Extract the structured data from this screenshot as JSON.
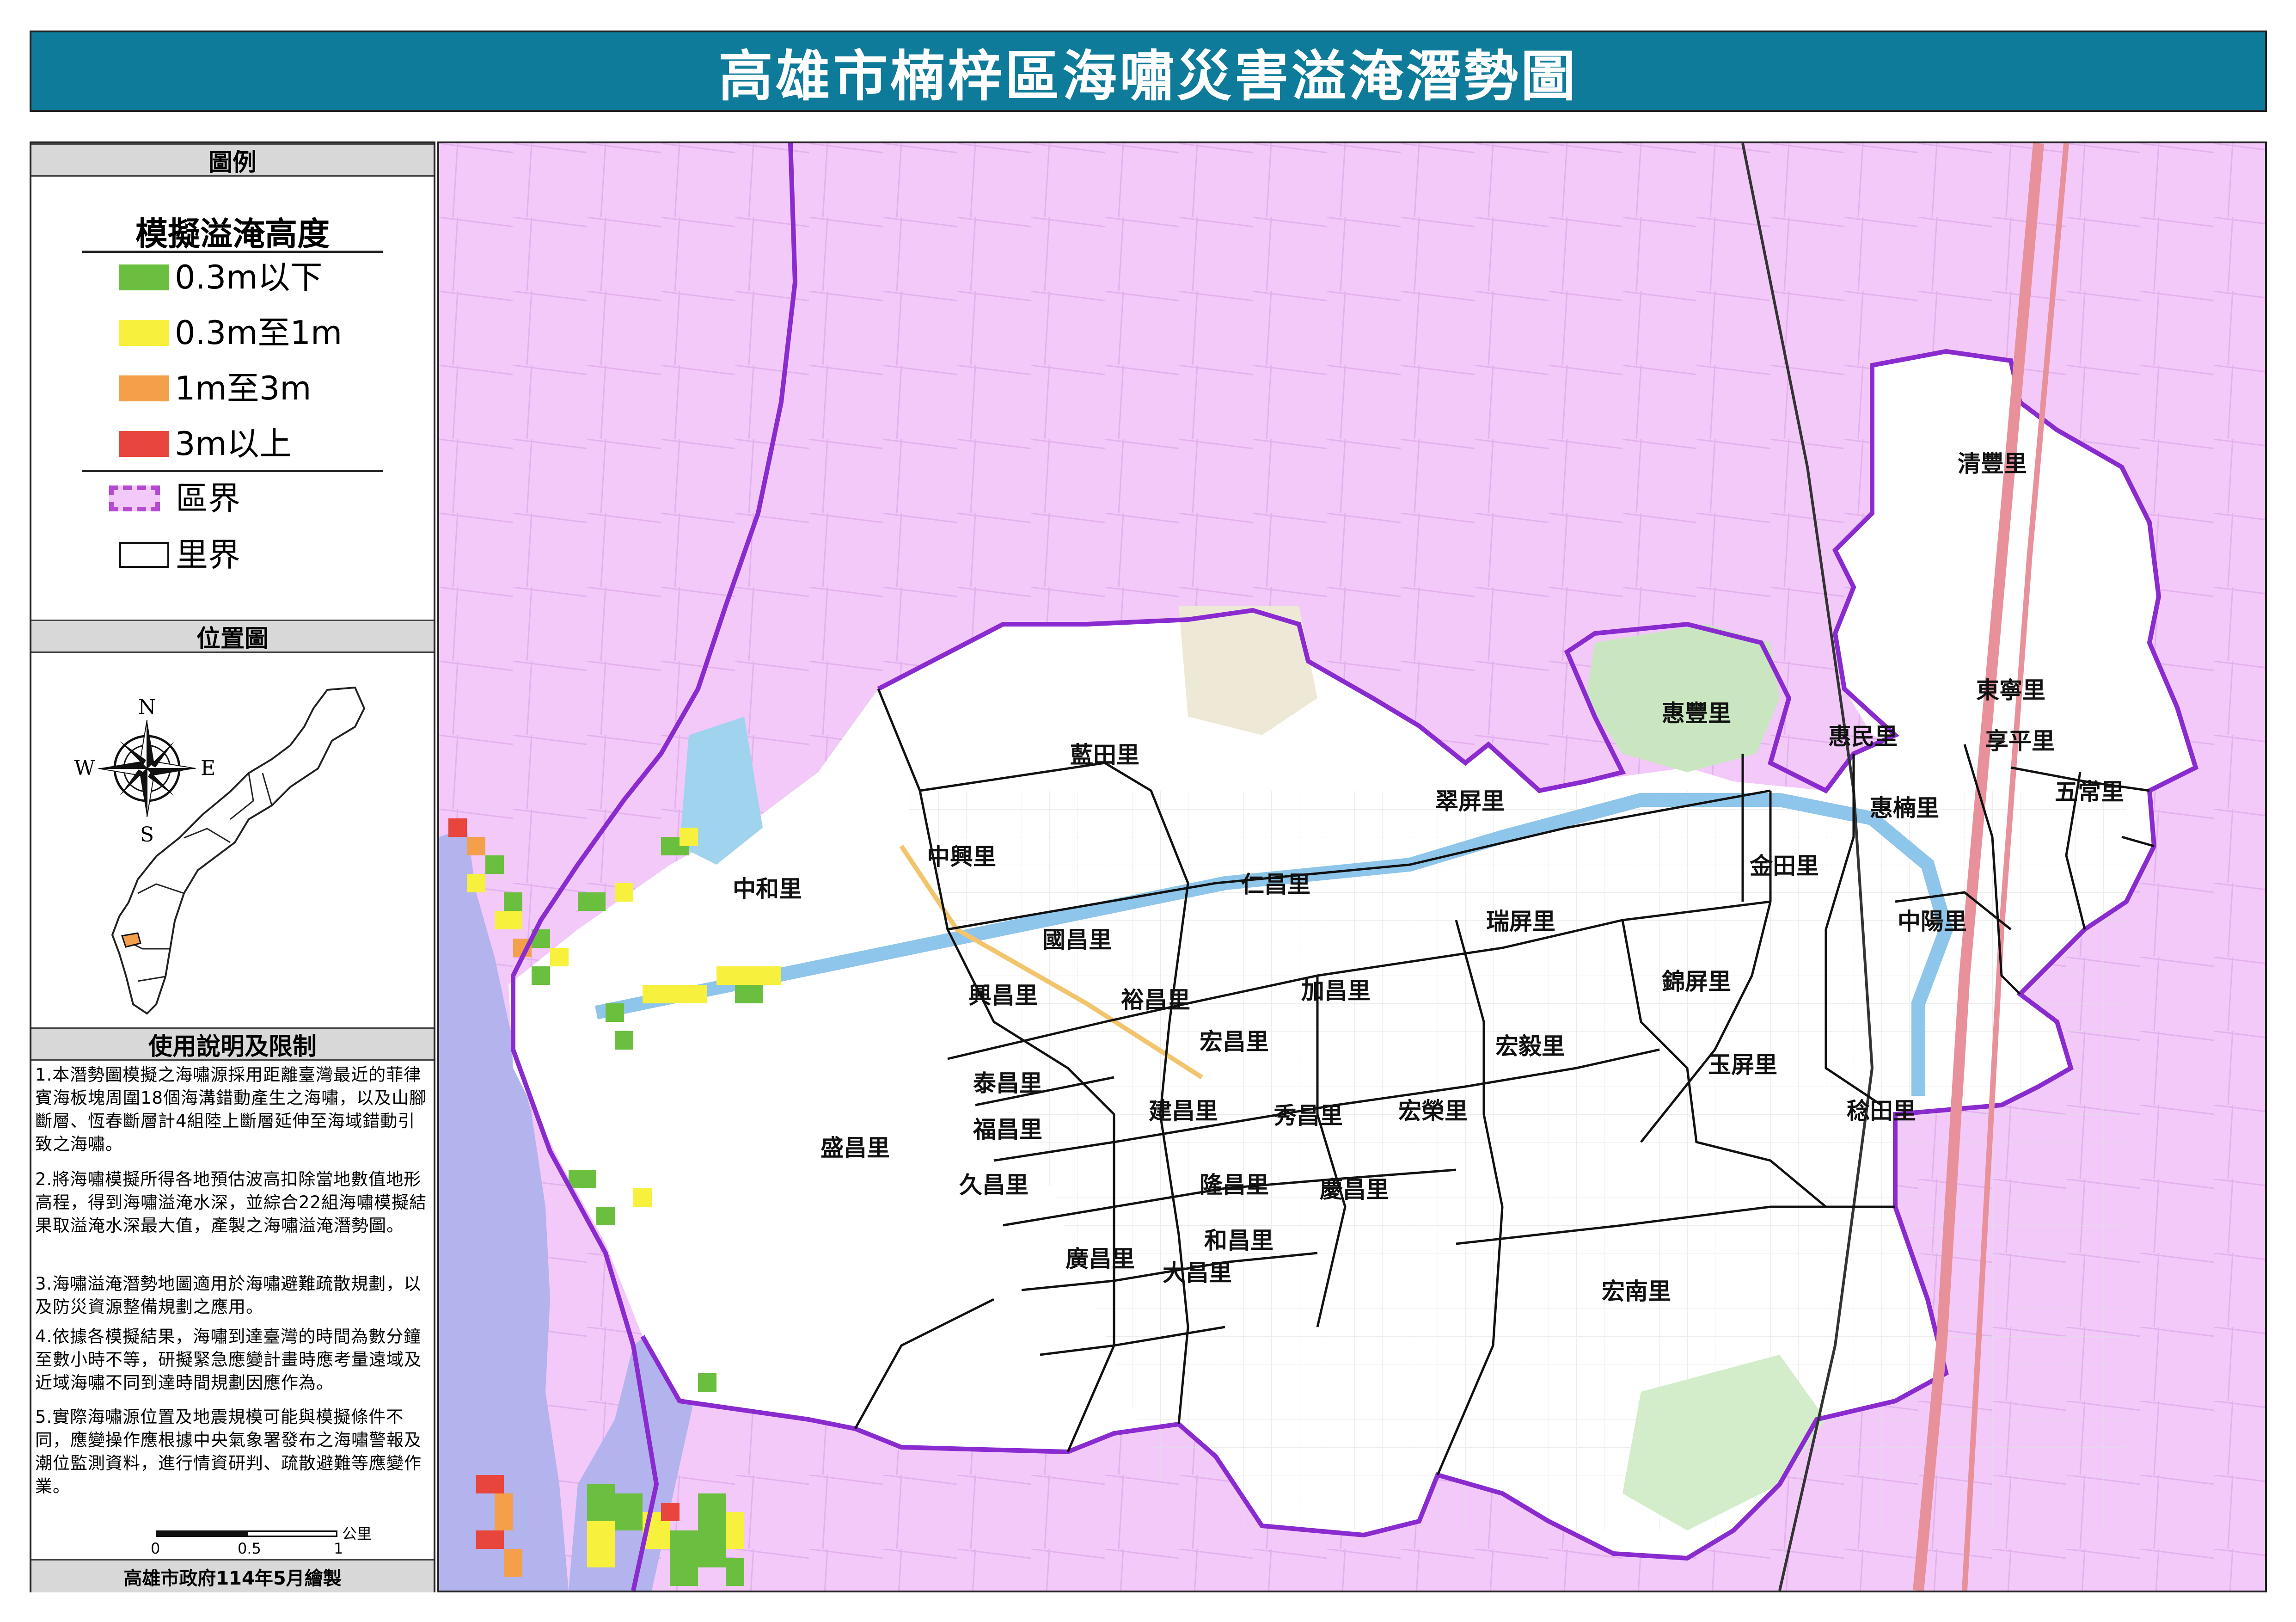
{
  "window_title": "高雄市楠梓區海嘯災害溢淹潛勢圖",
  "legend": {
    "title": "圖例",
    "subtitle": "模擬溢淹高度",
    "items": [
      {
        "label": "0.3m以下",
        "color": "#6bbf3f"
      },
      {
        "label": "0.3m至1m",
        "color": "#f7f03c"
      },
      {
        "label": "1m至3m",
        "color": "#f4a04a"
      },
      {
        "label": "3m以上",
        "color": "#e8453c"
      }
    ],
    "boundary_items": [
      {
        "label": "區界",
        "style": "dashed-purple"
      },
      {
        "label": "里界",
        "style": "solid-black"
      }
    ]
  },
  "location": {
    "title": "位置圖",
    "compass": {
      "n": "N",
      "s": "S",
      "e": "E",
      "w": "W"
    }
  },
  "notes": {
    "title": "使用說明及限制",
    "items": [
      "1.本潛勢圖模擬之海嘯源採用距離臺灣最近的菲律賓海板塊周圍18個海溝錯動產生之海嘯，以及山腳斷層、恆春斷層計4組陸上斷層延伸至海域錯動引致之海嘯。",
      "2.將海嘯模擬所得各地預估波高扣除當地數值地形高程，得到海嘯溢淹水深，並綜合22組海嘯模擬結果取溢淹水深最大值，產製之海嘯溢淹潛勢圖。",
      "3.海嘯溢淹潛勢地圖適用於海嘯避難疏散規劃，以及防災資源整備規劃之應用。",
      "4.依據各模擬結果，海嘯到達臺灣的時間為數分鐘至數小時不等，研擬緊急應變計畫時應考量遠域及近域海嘯不同到達時間規劃因應作為。",
      "5.實際海嘯源位置及地震規模可能與模擬條件不同，應變操作應根據中央氣象署發布之海嘯警報及潮位監測資料，進行情資研判、疏散避難等應變作業。"
    ]
  },
  "scale": {
    "ticks": [
      "0",
      "0.5",
      "1"
    ],
    "unit": "公里"
  },
  "footer": "高雄市政府114年5月繪製",
  "map": {
    "villages": [
      "清豐里",
      "東寧里",
      "惠豐里",
      "惠民里",
      "享平里",
      "五常里",
      "藍田里",
      "翠屏里",
      "惠楠里",
      "中興里",
      "中和里",
      "金田里",
      "仁昌里",
      "瑞屏里",
      "中陽里",
      "國昌里",
      "錦屏里",
      "興昌里",
      "裕昌里",
      "加昌里",
      "宏昌里",
      "宏毅里",
      "玉屏里",
      "泰昌里",
      "建昌里",
      "秀昌里",
      "宏榮里",
      "稔田里",
      "福昌里",
      "盛昌里",
      "隆昌里",
      "慶昌里",
      "久昌里",
      "和昌里",
      "廣昌里",
      "大昌里",
      "宏南里"
    ]
  }
}
